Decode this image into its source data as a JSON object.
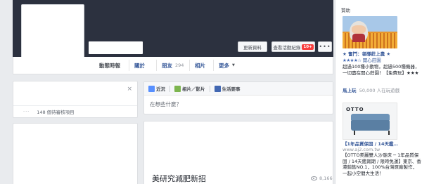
{
  "profile": {
    "update_info_label": "更新資料",
    "activity_log_label": "查看活動紀錄",
    "activity_log_badge": "10+",
    "more_button_label": "•••"
  },
  "nav": {
    "tabs": [
      {
        "label": "動態時報"
      },
      {
        "label": "關於"
      },
      {
        "label": "朋友",
        "count": "294"
      },
      {
        "label": "相片"
      },
      {
        "label": "更多",
        "caret": "▼"
      }
    ]
  },
  "left": {
    "close_glyph": "×",
    "dots": "···",
    "pending_text": "148 個待審核項目"
  },
  "composer": {
    "tabs": [
      "近況",
      "相片／影片",
      "生活要事"
    ],
    "prompt": "在想些什麼？"
  },
  "post": {
    "headline": "美研究減肥新招",
    "views": "8,166"
  },
  "sidebar": {
    "heading": "贊助",
    "ad1": {
      "title": "★ 奮鬥：領導莊上農 ★",
      "stars": "★★★★☆",
      "source": "開心莊園",
      "description": "超過100種小動物，超過500種機器，一切盡在開心莊園！【免費玩】★★★",
      "cta": "馬上玩",
      "likes": "50,000 人在玩遊戲"
    },
    "ad2": {
      "brand": "OTTO",
      "title": "【1年品質保固 / 14天鑑…",
      "url": "www.aj2.com.tw",
      "description": "【OTTO美麗雙人沙發床 ─ 1年品質保固 / 14天鑑賞期 / 限時免運】東京、香港銷售NO.1，100%台灣原廠製作，一起小空間大生活！"
    }
  }
}
